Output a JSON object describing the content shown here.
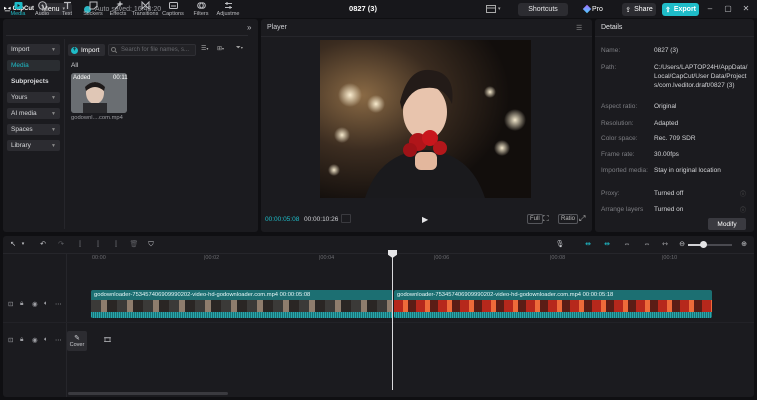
{
  "app": {
    "logo": "CapCut",
    "menu_label": "Menu",
    "autosave": "Auto saved: 16:43:20",
    "project_title": "0827 (3)",
    "shortcuts": "Shortcuts",
    "pro": "Pro",
    "share": "Share",
    "export": "Export",
    "accent": "#1fbcc8"
  },
  "toolbar": {
    "tabs": [
      {
        "label": "Media",
        "icon": "media-icon"
      },
      {
        "label": "Audio",
        "icon": "audio-icon"
      },
      {
        "label": "Text",
        "icon": "text-icon"
      },
      {
        "label": "Stickers",
        "icon": "sticker-icon"
      },
      {
        "label": "Effects",
        "icon": "effects-icon"
      },
      {
        "label": "Transitions",
        "icon": "transitions-icon"
      },
      {
        "label": "Captions",
        "icon": "captions-icon"
      },
      {
        "label": "Filters",
        "icon": "filters-icon"
      },
      {
        "label": "Adjustme",
        "icon": "adjust-icon"
      }
    ],
    "more": "»"
  },
  "sidebar": {
    "items": [
      {
        "label": "Import"
      },
      {
        "label": "Media"
      },
      {
        "label": "Subprojects"
      },
      {
        "label": "Yours"
      },
      {
        "label": "AI media"
      },
      {
        "label": "Spaces"
      },
      {
        "label": "Library"
      }
    ]
  },
  "media": {
    "import_label": "Import",
    "search_placeholder": "Search for file names, s...",
    "all_label": "All",
    "item": {
      "added": "Added",
      "duration": "00:11",
      "name": "godownl....com.mp4"
    }
  },
  "player": {
    "title": "Player",
    "current_time": "00:00:05:08",
    "total_time": "00:00:10:26",
    "full_label": "Full",
    "ratio_label": "Ratio"
  },
  "details": {
    "title": "Details",
    "rows": [
      {
        "key": "Name:",
        "value": "0827 (3)"
      },
      {
        "key": "Path:",
        "value": "C:/Users/LAPTOP24H/AppData/Local/CapCut/User Data/Projects/com.lveditor.draft/0827 (3)"
      },
      {
        "key": "Aspect ratio:",
        "value": "Original"
      },
      {
        "key": "Resolution:",
        "value": "Adapted"
      },
      {
        "key": "Color space:",
        "value": "Rec. 709 SDR"
      },
      {
        "key": "Frame rate:",
        "value": "30.00fps"
      },
      {
        "key": "Imported media:",
        "value": "Stay in original location"
      },
      {
        "key": "Proxy:",
        "value": "Turned off"
      },
      {
        "key": "Arrange layers",
        "value": "Turned on"
      }
    ],
    "modify": "Modify"
  },
  "timeline": {
    "ruler": [
      "00:00",
      "|00:02",
      "|00:04",
      "|00:06",
      "|00:08",
      "|00:10"
    ],
    "clip1_label": "godownloader-753457406909990202-video-hd-godownloader.com.mp4  00:00:05:08",
    "clip2_label": "godownloader-753457406909990202-video-hd-godownloader.com.mp4  00:00:05:18",
    "cover": "Cover"
  }
}
